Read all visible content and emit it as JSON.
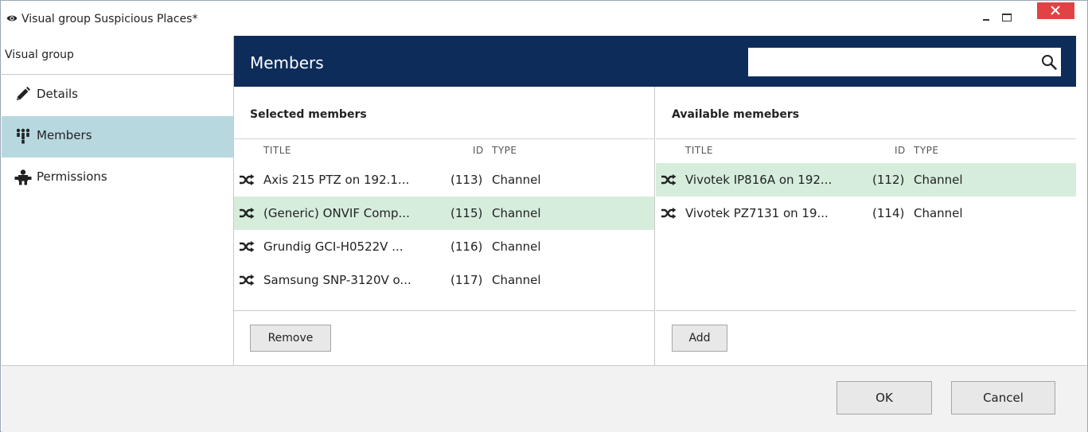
{
  "window": {
    "title": "Visual group Suspicious Places*",
    "close_color": "#e04343"
  },
  "nav": {
    "header": "Visual group",
    "items": [
      {
        "label": "Details",
        "icon": "pencil-icon"
      },
      {
        "label": "Members",
        "icon": "members-icon",
        "active": true
      },
      {
        "label": "Permissions",
        "icon": "permissions-icon"
      }
    ],
    "active_color": "#b8d8e0"
  },
  "main": {
    "title": "Members",
    "header_color": "#0d2c5a",
    "search": {
      "value": "",
      "placeholder": ""
    }
  },
  "selected": {
    "heading": "Selected members",
    "columns": {
      "title": "TITLE",
      "id": "ID",
      "type": "TYPE"
    },
    "rows": [
      {
        "title": "Axis 215 PTZ on 192.1...",
        "id": "(113)",
        "type": "Channel",
        "selected": false
      },
      {
        "title": "(Generic) ONVIF Comp...",
        "id": "(115)",
        "type": "Channel",
        "selected": true
      },
      {
        "title": "Grundig GCI-H0522V ...",
        "id": "(116)",
        "type": "Channel",
        "selected": false
      },
      {
        "title": "Samsung SNP-3120V o...",
        "id": "(117)",
        "type": "Channel",
        "selected": false
      }
    ],
    "button": "Remove"
  },
  "available": {
    "heading": "Available memebers",
    "columns": {
      "title": "TITLE",
      "id": "ID",
      "type": "TYPE"
    },
    "rows": [
      {
        "title": "Vivotek IP816A on 192...",
        "id": "(112)",
        "type": "Channel",
        "selected": true
      },
      {
        "title": "Vivotek PZ7131 on 19...",
        "id": "(114)",
        "type": "Channel",
        "selected": false
      }
    ],
    "button": "Add"
  },
  "footer": {
    "ok": "OK",
    "cancel": "Cancel"
  },
  "colors": {
    "row_selected": "#d6eddc"
  }
}
